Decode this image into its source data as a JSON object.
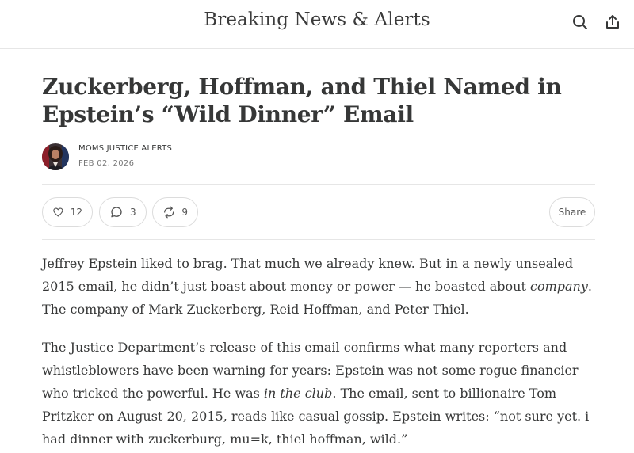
{
  "header": {
    "publication_title": "Breaking News & Alerts",
    "search_icon": "search-icon",
    "share_icon": "share-upload-icon"
  },
  "post": {
    "title_line1": "Zuckerberg, Hoffman, and Thiel Named in",
    "title_line2": "Epstein’s “Wild Dinner” Email",
    "author": "MOMS JUSTICE ALERTS",
    "date": "FEB 02, 2026",
    "engagement": {
      "likes": "12",
      "comments": "3",
      "restacks": "9",
      "share_label": "Share"
    },
    "paragraph1": {
      "l1": "Jeffrey Epstein liked to brag. That much we already knew. But in a newly unsealed",
      "l2_a": "2015 email, he didn’t just boast about money or power — he boasted about ",
      "l2_em": "company",
      "l2_b": ".",
      "l3": "The company of Mark Zuckerberg, Reid Hoffman, and Peter Thiel."
    },
    "paragraph2": {
      "l1": "The Justice Department’s release of this email confirms what many reporters and",
      "l2": "whistleblowers have been warning for years: Epstein was not some rogue financier",
      "l3_a": "who tricked the powerful. He was ",
      "l3_em": "in the club",
      "l3_b": ". The email, sent to billionaire Tom",
      "l4": "Pritzker on August 20, 2015, reads like casual gossip. Epstein writes: “not sure yet. i",
      "l5": "had dinner with zuckerburg, mu=k, thiel hoffman, wild.”"
    }
  }
}
